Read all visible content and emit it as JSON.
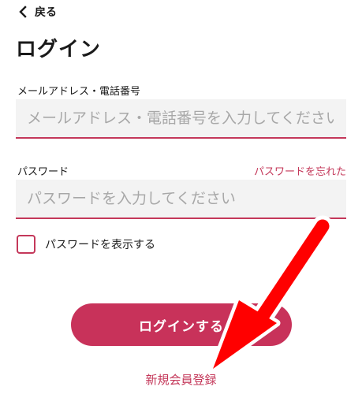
{
  "header": {
    "back_label": "戻る"
  },
  "page": {
    "title": "ログイン"
  },
  "form": {
    "email_label": "メールアドレス・電話番号",
    "email_placeholder": "メールアドレス・電話番号を入力してください",
    "email_value": "",
    "password_label": "パスワード",
    "forgot_password_label": "パスワードを忘れた",
    "password_placeholder": "パスワードを入力してください",
    "password_value": "",
    "show_password_label": "パスワードを表示する",
    "show_password_checked": false,
    "login_button_label": "ログインする",
    "register_link_label": "新規会員登録"
  },
  "colors": {
    "accent": "#c4385a",
    "button": "#c8325a",
    "input_bg": "#f3f3f3",
    "annotation_arrow": "#ff0000"
  },
  "icons": {
    "back": "chevron-left-icon",
    "annotation": "red-arrow-icon"
  }
}
